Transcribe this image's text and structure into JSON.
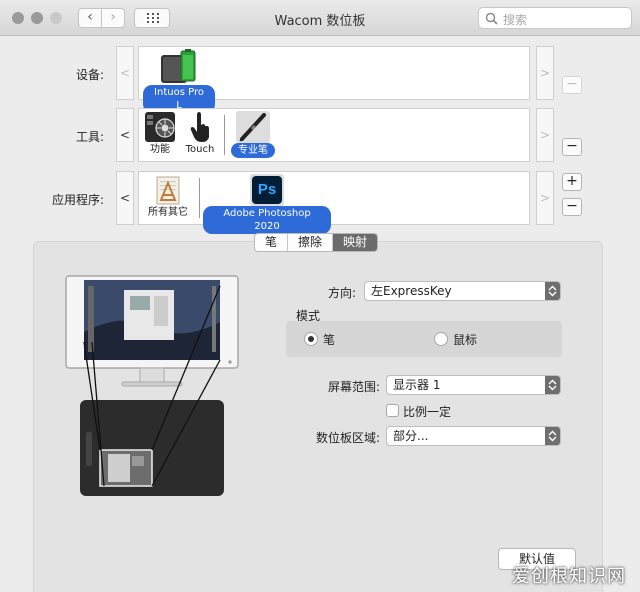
{
  "window": {
    "title": "Wacom 数位板",
    "search_placeholder": "搜索",
    "back_glyph": "‹",
    "forward_glyph": "›"
  },
  "rows": {
    "devices": {
      "label": "设备:",
      "items": [
        {
          "label": "Intuos Pro L",
          "selected": true,
          "icon": "tablet-battery-icon"
        }
      ],
      "minus": "−"
    },
    "tools": {
      "label": "工具:",
      "items": [
        {
          "label": "功能",
          "selected": false,
          "icon": "function-keys-icon"
        },
        {
          "label": "Touch",
          "selected": false,
          "icon": "touch-hand-icon"
        },
        {
          "label": "专业笔",
          "selected": true,
          "icon": "pro-pen-icon"
        }
      ],
      "minus": "−"
    },
    "apps": {
      "label": "应用程序:",
      "items": [
        {
          "label": "所有其它",
          "selected": false,
          "icon": "all-other-apps-icon"
        },
        {
          "label": "Adobe Photoshop 2020",
          "selected": true,
          "icon": "photoshop-icon",
          "icon_text": "Ps"
        }
      ],
      "plus": "+",
      "minus": "−"
    },
    "left_arrow": "<",
    "right_arrow": ">"
  },
  "tabs": [
    {
      "label": "笔",
      "active": false
    },
    {
      "label": "擦除",
      "active": false
    },
    {
      "label": "映射",
      "active": true
    }
  ],
  "mapping": {
    "orientation_label": "方向:",
    "orientation_value": "左ExpressKey",
    "mode_label": "模式",
    "mode_pen": "笔",
    "mode_mouse": "鼠标",
    "mode_selected": "笔",
    "screen_area_label": "屏幕范围:",
    "screen_area_value": "显示器 1",
    "force_proportions_label": "比例一定",
    "force_proportions_checked": false,
    "tablet_area_label": "数位板区域:",
    "tablet_area_value": "部分...",
    "default_button": "默认值"
  },
  "watermark": "爱创根知识网",
  "colors": {
    "accent": "#2f6bd8",
    "active_tab": "#6b6b6b",
    "photoshop_bg": "#001e36",
    "photoshop_fg": "#31a8ff"
  }
}
